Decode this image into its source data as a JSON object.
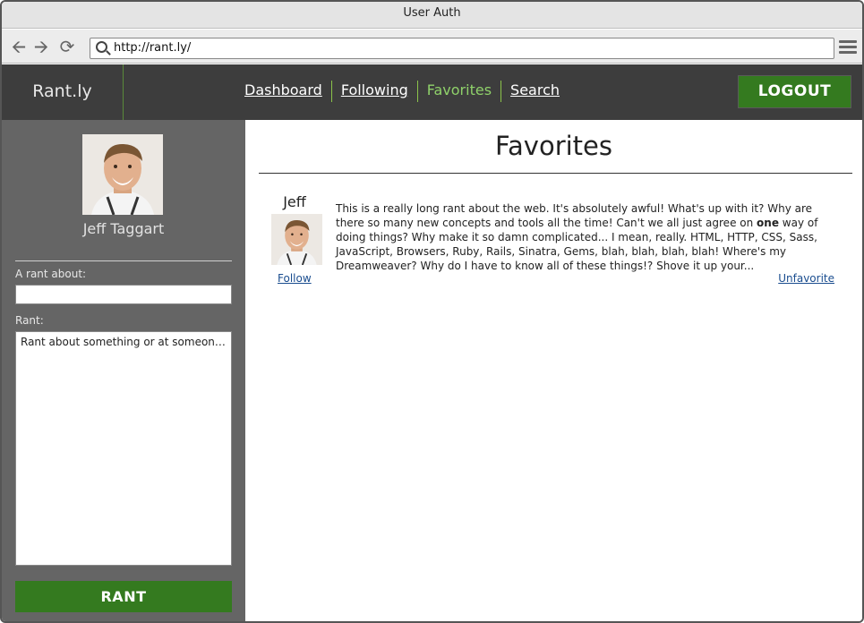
{
  "window": {
    "title": "User Auth"
  },
  "browser": {
    "url": "http://rant.ly/",
    "back_icon": "arrow-left-icon",
    "forward_icon": "arrow-right-icon",
    "reload_icon": "reload-icon",
    "menu_icon": "hamburger-menu-icon"
  },
  "nav": {
    "brand": "Rant.ly",
    "links": [
      {
        "label": "Dashboard",
        "active": false
      },
      {
        "label": "Following",
        "active": false
      },
      {
        "label": "Favorites",
        "active": true
      },
      {
        "label": "Search",
        "active": false
      }
    ],
    "logout_label": "LOGOUT"
  },
  "sidebar": {
    "user_name": "Jeff Taggart",
    "rant_about_label": "A rant about:",
    "rant_about_value": "",
    "rant_label": "Rant:",
    "rant_placeholder": "Rant about something or at someone...",
    "submit_label": "RANT"
  },
  "main": {
    "title": "Favorites",
    "rants": [
      {
        "author": "Jeff",
        "follow_label": "Follow",
        "text_before": "This is a really long rant about the web. It's absolutely awful! What's up with it? Why are there so many new concepts and tools all the time! Can't we all just agree on ",
        "text_bold": "one",
        "text_after": " way of doing things? Why make it so damn complicated... I mean, really. HTML, HTTP, CSS, Sass, JavaScript, Browsers, Ruby, Rails, Sinatra, Gems, blah, blah, blah, blah! Where's my Dreamweaver? Why do I have to know all of these things!? Shove it up your...",
        "unfavorite_label": "Unfavorite"
      }
    ]
  },
  "colors": {
    "accent_green": "#347a1f",
    "nav_active": "#8fd16a",
    "nav_bg": "#3d3d3d",
    "sidebar_bg": "#656565",
    "link_blue": "#1a4d8f"
  }
}
